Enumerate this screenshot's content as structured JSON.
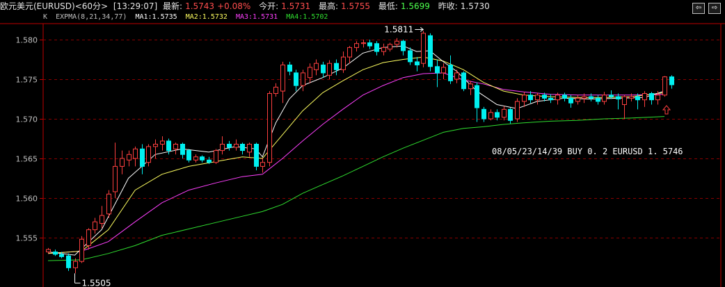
{
  "header": {
    "symbol": "欧元美元(EURUSD)<60分>",
    "time": "[13:29:07]",
    "last_label": "最新:",
    "last_value": "1.5743",
    "change": "+0.08%",
    "open_label": "今开:",
    "open_value": "1.5731",
    "high_label": "最高:",
    "high_value": "1.5755",
    "low_label": "最低:",
    "low_value": "1.5699",
    "prev_label": "昨收:",
    "prev_value": "1.5730"
  },
  "nav": {
    "prev_icon": "⇦",
    "next_icon": "⇨"
  },
  "legend": {
    "k": "K",
    "indicator": "EXPMA(8,21,34,77)",
    "ma1": "MA1:1.5735",
    "ma2": "MA2:1.5732",
    "ma3": "MA3:1.5731",
    "ma4": "MA4:1.5702"
  },
  "colors": {
    "up": "#ff4040",
    "down": "#00f0f0",
    "ma1": "#ffffff",
    "ma2": "#ffff60",
    "ma3": "#ff40ff",
    "ma4": "#30e030",
    "grid": "#8b0000",
    "axis": "#c00000",
    "tick_text": "#c0c0c0"
  },
  "chart_data": {
    "type": "candlestick",
    "y_ticks": [
      "1.555",
      "1.560",
      "1.565",
      "1.570",
      "1.575",
      "1.580"
    ],
    "ylim": [
      1.5505,
      1.5825
    ],
    "grid": "horizontal dashed",
    "candles": [
      [
        1.5532,
        1.5535,
        1.553,
        1.5537
      ],
      [
        1.5532,
        1.5529,
        1.5527,
        1.5535
      ],
      [
        1.5529,
        1.5526,
        1.5524,
        1.5532
      ],
      [
        1.5527,
        1.5512,
        1.5508,
        1.553
      ],
      [
        1.5512,
        1.552,
        1.5505,
        1.5524
      ],
      [
        1.552,
        1.5548,
        1.5518,
        1.5552
      ],
      [
        1.554,
        1.556,
        1.5535,
        1.5562
      ],
      [
        1.556,
        1.557,
        1.5555,
        1.5575
      ],
      [
        1.5568,
        1.5578,
        1.5562,
        1.559
      ],
      [
        1.558,
        1.5605,
        1.5575,
        1.561
      ],
      [
        1.5608,
        1.564,
        1.56,
        1.567
      ],
      [
        1.564,
        1.565,
        1.563,
        1.566
      ],
      [
        1.5648,
        1.5655,
        1.564,
        1.566
      ],
      [
        1.565,
        1.5662,
        1.564,
        1.5665
      ],
      [
        1.5662,
        1.564,
        1.563,
        1.5668
      ],
      [
        1.5645,
        1.5665,
        1.564,
        1.5668
      ],
      [
        1.5665,
        1.5668,
        1.565,
        1.5674
      ],
      [
        1.5668,
        1.5672,
        1.566,
        1.5678
      ],
      [
        1.5672,
        1.566,
        1.5655,
        1.5675
      ],
      [
        1.5662,
        1.5668,
        1.5655,
        1.567
      ],
      [
        1.5668,
        1.5655,
        1.565,
        1.567
      ],
      [
        1.566,
        1.5648,
        1.5645,
        1.5662
      ],
      [
        1.5648,
        1.5652,
        1.5645,
        1.5655
      ],
      [
        1.5652,
        1.5648,
        1.5645,
        1.5654
      ],
      [
        1.5648,
        1.5645,
        1.5643,
        1.5652
      ],
      [
        1.5645,
        1.566,
        1.5643,
        1.5662
      ],
      [
        1.566,
        1.5668,
        1.5655,
        1.5678
      ],
      [
        1.5668,
        1.5664,
        1.566,
        1.5672
      ],
      [
        1.5664,
        1.5668,
        1.566,
        1.5674
      ],
      [
        1.5668,
        1.566,
        1.5655,
        1.567
      ],
      [
        1.5658,
        1.5668,
        1.5652,
        1.567
      ],
      [
        1.5668,
        1.564,
        1.5635,
        1.567
      ],
      [
        1.564,
        1.5645,
        1.5632,
        1.565
      ],
      [
        1.5645,
        1.5732,
        1.564,
        1.5735
      ],
      [
        1.5732,
        1.574,
        1.5728,
        1.5745
      ],
      [
        1.5735,
        1.5768,
        1.572,
        1.5772
      ],
      [
        1.5768,
        1.576,
        1.5755,
        1.5772
      ],
      [
        1.5758,
        1.5742,
        1.5735,
        1.5762
      ],
      [
        1.5742,
        1.5758,
        1.5735,
        1.5762
      ],
      [
        1.5752,
        1.5765,
        1.5745,
        1.577
      ],
      [
        1.5762,
        1.577,
        1.5755,
        1.5775
      ],
      [
        1.5768,
        1.5758,
        1.5752,
        1.5772
      ],
      [
        1.5755,
        1.577,
        1.575,
        1.5774
      ],
      [
        1.577,
        1.5762,
        1.5755,
        1.5775
      ],
      [
        1.5762,
        1.5778,
        1.5758,
        1.5785
      ],
      [
        1.5778,
        1.579,
        1.577,
        1.5792
      ],
      [
        1.579,
        1.5795,
        1.5785,
        1.5798
      ],
      [
        1.5795,
        1.5796,
        1.579,
        1.58
      ],
      [
        1.5796,
        1.5792,
        1.5788,
        1.58
      ],
      [
        1.5795,
        1.5785,
        1.578,
        1.5798
      ],
      [
        1.5785,
        1.579,
        1.578,
        1.5795
      ],
      [
        1.5788,
        1.5794,
        1.5785,
        1.5796
      ],
      [
        1.5794,
        1.5798,
        1.579,
        1.5802
      ],
      [
        1.5798,
        1.5786,
        1.578,
        1.58
      ],
      [
        1.5786,
        1.5772,
        1.5768,
        1.579
      ],
      [
        1.5772,
        1.5768,
        1.576,
        1.5778
      ],
      [
        1.577,
        1.5808,
        1.5765,
        1.5811
      ],
      [
        1.5805,
        1.5766,
        1.576,
        1.5808
      ],
      [
        1.5766,
        1.5758,
        1.574,
        1.5775
      ],
      [
        1.5758,
        1.5765,
        1.575,
        1.577
      ],
      [
        1.5768,
        1.5748,
        1.5744,
        1.578
      ],
      [
        1.575,
        1.5758,
        1.5745,
        1.5762
      ],
      [
        1.5758,
        1.5738,
        1.5735,
        1.576
      ],
      [
        1.5738,
        1.5744,
        1.573,
        1.5748
      ],
      [
        1.5742,
        1.5714,
        1.5696,
        1.5746
      ],
      [
        1.5712,
        1.57,
        1.5696,
        1.5715
      ],
      [
        1.57,
        1.5708,
        1.5698,
        1.5712
      ],
      [
        1.5708,
        1.5702,
        1.5698,
        1.5712
      ],
      [
        1.5702,
        1.5712,
        1.5698,
        1.5716
      ],
      [
        1.5712,
        1.5698,
        1.5694,
        1.5714
      ],
      [
        1.57,
        1.5722,
        1.5696,
        1.5726
      ],
      [
        1.5722,
        1.573,
        1.5715,
        1.5734
      ],
      [
        1.573,
        1.5724,
        1.572,
        1.5735
      ],
      [
        1.5724,
        1.573,
        1.5718,
        1.5733
      ],
      [
        1.573,
        1.5726,
        1.5722,
        1.5733
      ],
      [
        1.5726,
        1.5724,
        1.572,
        1.5731
      ],
      [
        1.5724,
        1.573,
        1.5718,
        1.5733
      ],
      [
        1.573,
        1.5726,
        1.5722,
        1.5733
      ],
      [
        1.5726,
        1.572,
        1.5714,
        1.573
      ],
      [
        1.5722,
        1.5726,
        1.5718,
        1.573
      ],
      [
        1.5726,
        1.5728,
        1.572,
        1.5732
      ],
      [
        1.5728,
        1.5726,
        1.5722,
        1.5732
      ],
      [
        1.5726,
        1.5722,
        1.5718,
        1.573
      ],
      [
        1.5722,
        1.573,
        1.5718,
        1.5734
      ],
      [
        1.573,
        1.5728,
        1.5725,
        1.5736
      ],
      [
        1.5728,
        1.5725,
        1.5712,
        1.5732
      ],
      [
        1.5718,
        1.5728,
        1.57,
        1.573
      ],
      [
        1.5726,
        1.5728,
        1.5722,
        1.5732
      ],
      [
        1.5728,
        1.5724,
        1.5712,
        1.5732
      ],
      [
        1.5724,
        1.5732,
        1.5715,
        1.5735
      ],
      [
        1.5732,
        1.5724,
        1.5718,
        1.5734
      ],
      [
        1.5724,
        1.573,
        1.5718,
        1.5735
      ],
      [
        1.573,
        1.5753,
        1.5728,
        1.5754
      ],
      [
        1.5753,
        1.5743,
        1.5738,
        1.5755
      ]
    ],
    "ma1": [
      [
        0,
        1.5532
      ],
      [
        4,
        1.5528
      ],
      [
        8,
        1.556
      ],
      [
        12,
        1.5625
      ],
      [
        16,
        1.5655
      ],
      [
        20,
        1.5662
      ],
      [
        24,
        1.5658
      ],
      [
        28,
        1.5665
      ],
      [
        31,
        1.5662
      ],
      [
        32,
        1.5652
      ],
      [
        34,
        1.5695
      ],
      [
        36,
        1.5725
      ],
      [
        38,
        1.5742
      ],
      [
        41,
        1.5752
      ],
      [
        44,
        1.5764
      ],
      [
        47,
        1.5783
      ],
      [
        50,
        1.579
      ],
      [
        53,
        1.5792
      ],
      [
        55,
        1.5785
      ],
      [
        57,
        1.5786
      ],
      [
        59,
        1.5772
      ],
      [
        61,
        1.576
      ],
      [
        64,
        1.5735
      ],
      [
        67,
        1.5718
      ],
      [
        70,
        1.5713
      ],
      [
        73,
        1.5722
      ],
      [
        77,
        1.5726
      ],
      [
        81,
        1.5725
      ],
      [
        85,
        1.5726
      ],
      [
        89,
        1.5727
      ],
      [
        92,
        1.5735
      ]
    ],
    "ma2": [
      [
        0,
        1.553
      ],
      [
        5,
        1.5533
      ],
      [
        9,
        1.556
      ],
      [
        13,
        1.561
      ],
      [
        17,
        1.563
      ],
      [
        21,
        1.564
      ],
      [
        25,
        1.5646
      ],
      [
        29,
        1.5652
      ],
      [
        32,
        1.565
      ],
      [
        35,
        1.568
      ],
      [
        38,
        1.571
      ],
      [
        41,
        1.5733
      ],
      [
        44,
        1.5748
      ],
      [
        47,
        1.5762
      ],
      [
        50,
        1.5771
      ],
      [
        53,
        1.5775
      ],
      [
        56,
        1.5778
      ],
      [
        59,
        1.5773
      ],
      [
        62,
        1.5762
      ],
      [
        65,
        1.5746
      ],
      [
        68,
        1.5735
      ],
      [
        71,
        1.573
      ],
      [
        75,
        1.5728
      ],
      [
        79,
        1.5727
      ],
      [
        83,
        1.5727
      ],
      [
        87,
        1.5728
      ],
      [
        92,
        1.5733
      ]
    ],
    "ma3": [
      [
        0,
        1.553
      ],
      [
        5,
        1.5533
      ],
      [
        9,
        1.5545
      ],
      [
        13,
        1.557
      ],
      [
        17,
        1.5594
      ],
      [
        21,
        1.561
      ],
      [
        25,
        1.5619
      ],
      [
        29,
        1.5627
      ],
      [
        32,
        1.563
      ],
      [
        35,
        1.565
      ],
      [
        38,
        1.5672
      ],
      [
        41,
        1.5693
      ],
      [
        44,
        1.5712
      ],
      [
        47,
        1.573
      ],
      [
        50,
        1.5742
      ],
      [
        53,
        1.5752
      ],
      [
        56,
        1.5757
      ],
      [
        59,
        1.5758
      ],
      [
        62,
        1.5749
      ],
      [
        65,
        1.5744
      ],
      [
        68,
        1.5737
      ],
      [
        71,
        1.5734
      ],
      [
        75,
        1.5731
      ],
      [
        79,
        1.573
      ],
      [
        83,
        1.573
      ],
      [
        87,
        1.573
      ],
      [
        92,
        1.5731
      ]
    ],
    "ma4": [
      [
        0,
        1.5521
      ],
      [
        5,
        1.5522
      ],
      [
        9,
        1.553
      ],
      [
        13,
        1.554
      ],
      [
        17,
        1.5553
      ],
      [
        21,
        1.5561
      ],
      [
        25,
        1.5569
      ],
      [
        29,
        1.5577
      ],
      [
        32,
        1.5583
      ],
      [
        35,
        1.5592
      ],
      [
        38,
        1.5606
      ],
      [
        41,
        1.5617
      ],
      [
        44,
        1.5628
      ],
      [
        47,
        1.564
      ],
      [
        50,
        1.5652
      ],
      [
        53,
        1.5663
      ],
      [
        56,
        1.5673
      ],
      [
        59,
        1.5683
      ],
      [
        62,
        1.5688
      ],
      [
        65,
        1.569
      ],
      [
        68,
        1.5693
      ],
      [
        71,
        1.5695
      ],
      [
        75,
        1.5697
      ],
      [
        79,
        1.5698
      ],
      [
        83,
        1.57
      ],
      [
        87,
        1.5701
      ],
      [
        92,
        1.5703
      ]
    ],
    "annotations": {
      "high_label": "1.5811",
      "low_label": "1.5505",
      "trade_text": "08/05/23/14/39 BUY  0. 2 EURUSD 1. 5746"
    }
  }
}
